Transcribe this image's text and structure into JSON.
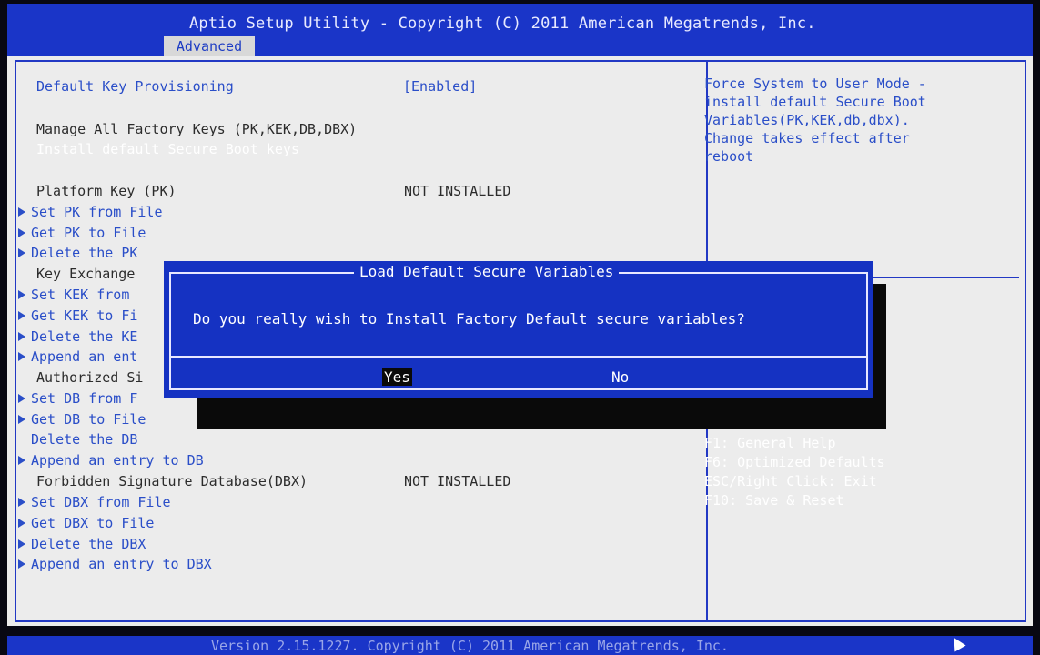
{
  "header": {
    "title": "Aptio Setup Utility - Copyright (C) 2011 American Megatrends, Inc.",
    "tab": "Advanced"
  },
  "settings": {
    "default_key_provisioning": {
      "label": "Default Key Provisioning",
      "value": "[Enabled]"
    },
    "manage_all": "Manage All Factory Keys (PK,KEK,DB,DBX)",
    "install_default": "Install default Secure Boot keys",
    "platform_key": {
      "label": "Platform Key (PK)",
      "value": "NOT INSTALLED"
    },
    "set_pk": "Set PK from File",
    "get_pk": "Get PK to File",
    "delete_pk": "Delete the PK",
    "key_exchange": "Key Exchange",
    "set_kek": "Set KEK from",
    "get_kek": "Get KEK to Fi",
    "delete_kek": "Delete the KE",
    "append_kek": "Append an ent",
    "authorized_sig": "Authorized Si",
    "set_db": "Set DB from F",
    "get_db": "Get DB to File",
    "delete_db": "Delete the DB",
    "append_db": "Append an entry to DB",
    "forbidden_sig": {
      "label": "Forbidden Signature Database(DBX)",
      "value": "NOT INSTALLED"
    },
    "set_dbx": "Set DBX from File",
    "get_dbx": "Get DBX to File",
    "delete_dbx": "Delete the DBX",
    "append_dbx": "Append an entry to DBX"
  },
  "help": {
    "lines": [
      "Force System to User Mode -",
      "install default Secure Boot",
      "Variables(PK,KEK,db,dbx).",
      "Change takes effect after",
      "reboot"
    ]
  },
  "keys": {
    "f1": "F1: General Help",
    "f6": "F6: Optimized Defaults",
    "esc": "ESC/Right Click: Exit",
    "f10": "F10: Save & Reset"
  },
  "dialog": {
    "title": "Load Default Secure Variables",
    "message": "Do you really wish to Install Factory Default secure variables?",
    "yes": "Yes",
    "no": "No"
  },
  "footer": {
    "version": "Version 2.15.1227. Copyright (C) 2011 American Megatrends, Inc."
  },
  "colors": {
    "header_bg": "#1a35c8",
    "panel_bg": "#ececec",
    "link_text": "#2a4ec8",
    "dialog_bg": "#1532c2"
  },
  "icons": {
    "submenu": "submenu-arrow-icon",
    "pointer": "mouse-pointer-icon"
  }
}
